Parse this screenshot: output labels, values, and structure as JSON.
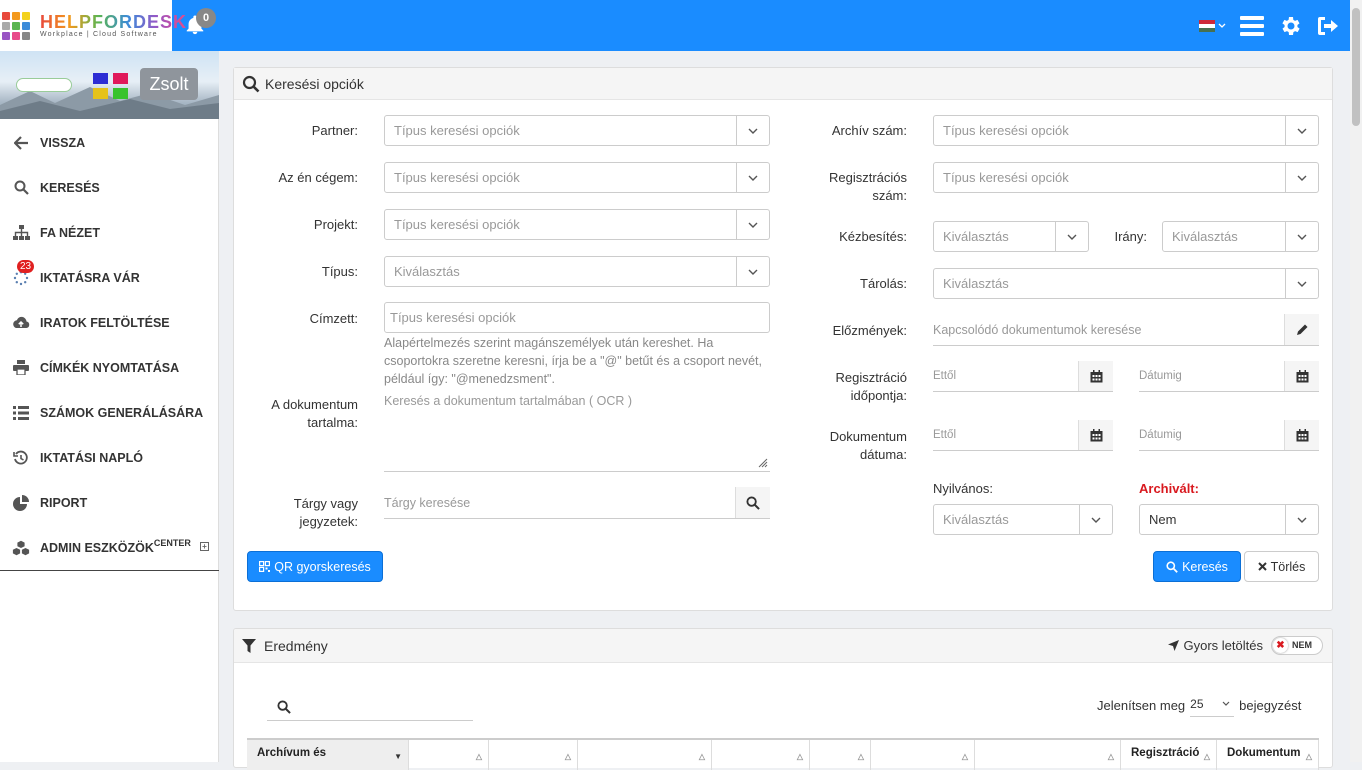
{
  "app": {
    "logo_text": "HELPFORDESK",
    "logo_sub": "Workplace | Cloud Software",
    "notifications": "0"
  },
  "profile": {
    "user": "Zsolt"
  },
  "sidebar": {
    "items": [
      {
        "label": "VISSZA",
        "icon": "arrow-left-icon"
      },
      {
        "label": "KERESÉS",
        "icon": "search-icon"
      },
      {
        "label": "FA NÉZET",
        "icon": "sitemap-icon"
      },
      {
        "label": "IKTATÁSRA VÁR",
        "icon": "spinner-icon",
        "badge": "23"
      },
      {
        "label": "IRATOK FELTÖLTÉSE",
        "icon": "cloud-upload-icon"
      },
      {
        "label": "CÍMKÉK NYOMTATÁSA",
        "icon": "print-icon"
      },
      {
        "label": "SZÁMOK GENERÁLÁSÁRA",
        "icon": "list-icon"
      },
      {
        "label": "IKTATÁSI NAPLÓ",
        "icon": "history-icon"
      },
      {
        "label": "RIPORT",
        "icon": "pie-chart-icon"
      },
      {
        "label": "ADMIN ESZKÖZÖK",
        "sup": "CENTER",
        "icon": "cubes-icon"
      }
    ]
  },
  "search": {
    "title": "Keresési opciók",
    "left": {
      "partner_label": "Partner:",
      "partner_ph": "Típus keresési opciók",
      "company_label": "Az én cégem:",
      "company_ph": "Típus keresési opciók",
      "project_label": "Projekt:",
      "project_ph": "Típus keresési opciók",
      "type_label": "Típus:",
      "type_ph": "Kiválasztás",
      "recipient_label": "Címzett:",
      "recipient_ph": "Típus keresési opciók",
      "recipient_help": "Alapértelmezés szerint magánszemélyek után kereshet. Ha csoportokra szeretne keresni, írja be a \"@\" betűt és a csoport nevét, például így: \"@menedzsment\".",
      "content_label_1": "A dokumentum",
      "content_label_2": "tartalma:",
      "content_ph": "Keresés a dokumentum tartalmában ( OCR )",
      "subject_label_1": "Tárgy vagy",
      "subject_label_2": "jegyzetek:",
      "subject_ph": "Tárgy keresése"
    },
    "right": {
      "archive_label": "Archív szám:",
      "archive_ph": "Típus keresési opciók",
      "reg_label_1": "Regisztrációs",
      "reg_label_2": "szám:",
      "reg_ph": "Típus keresési opciók",
      "delivery_label": "Kézbesítés:",
      "delivery_ph": "Kiválasztás",
      "direction_label": "Irány:",
      "direction_ph": "Kiválasztás",
      "storage_label": "Tárolás:",
      "storage_ph": "Kiválasztás",
      "history_label": "Előzmények:",
      "history_ph": "Kapcsolódó dokumentumok keresése",
      "regdate_label_1": "Regisztráció",
      "regdate_label_2": "időpontja:",
      "docdate_label_1": "Dokumentum",
      "docdate_label_2": "dátuma:",
      "from_ph": "Ettől",
      "to_ph": "Dátumig",
      "public_label": "Nyilvános:",
      "public_ph": "Kiválasztás",
      "archived_label": "Archivált:",
      "archived_value": "Nem"
    },
    "qr_button": "QR gyorskeresés",
    "search_button": "Keresés",
    "clear_button": "Törlés"
  },
  "results": {
    "title": "Eredmény",
    "quick_download": "Gyors letöltés",
    "toggle_value": "NEM",
    "show_prefix": "Jelenítsen meg",
    "page_size": "25",
    "show_suffix": "bejegyzést",
    "columns": [
      "Archívum és",
      "",
      "",
      "",
      "",
      "",
      "",
      "",
      "Regisztráció",
      "Dokumentum"
    ]
  },
  "colors": {
    "accent": "#1a8cff",
    "danger": "#d9191f"
  }
}
